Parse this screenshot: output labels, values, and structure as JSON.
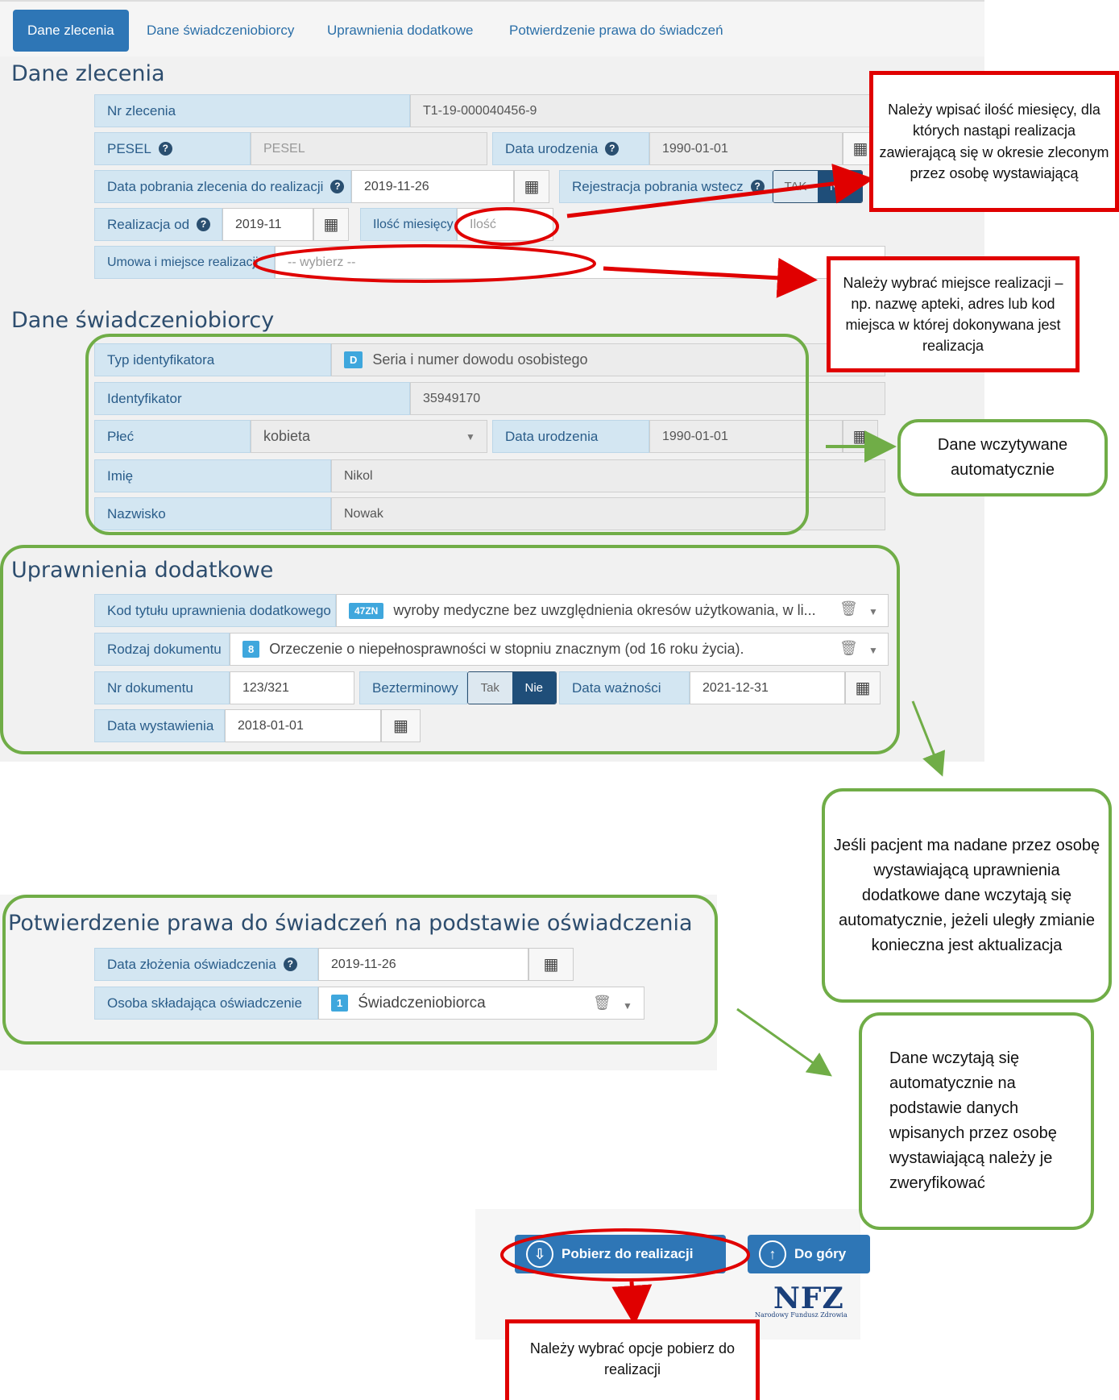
{
  "tabs": [
    "Dane zlecenia",
    "Dane świadczeniobiorcy",
    "Uprawnienia dodatkowe",
    "Potwierdzenie prawa do świadczeń"
  ],
  "dane_zlecenia": {
    "title": "Dane zlecenia",
    "nr_zlecenia_label": "Nr zlecenia",
    "nr_zlecenia_value": "T1-19-000040456-9",
    "pesel_label": "PESEL",
    "pesel_placeholder": "PESEL",
    "data_urodzenia_label": "Data urodzenia",
    "data_urodzenia_value": "1990-01-01",
    "data_pobrania_label": "Data pobrania zlecenia do realizacji",
    "data_pobrania_value": "2019-11-26",
    "rejestracja_label": "Rejestracja pobrania wstecz",
    "tak": "TAK",
    "nie": "NIE",
    "realizacja_od_label": "Realizacja od",
    "realizacja_od_value": "2019-11",
    "ilosc_label": "Ilość miesięcy",
    "ilosc_placeholder": "Ilość",
    "umowa_label": "Umowa i miejsce realizacji",
    "umowa_placeholder": "-- wybierz --"
  },
  "swiadczeniobiorca": {
    "title": "Dane świadczeniobiorcy",
    "typ_label": "Typ identyfikatora",
    "typ_badge": "D",
    "typ_value": "Seria i numer dowodu osobistego",
    "identyfikator_label": "Identyfikator",
    "identyfikator_value": "35949170",
    "plec_label": "Płeć",
    "plec_value": "kobieta",
    "data_urodzenia_label": "Data urodzenia",
    "data_urodzenia_value": "1990-01-01",
    "imie_label": "Imię",
    "imie_value": "Nikol",
    "nazwisko_label": "Nazwisko",
    "nazwisko_value": "Nowak"
  },
  "uprawnienia": {
    "title": "Uprawnienia dodatkowe",
    "kod_label": "Kod tytułu uprawnienia dodatkowego",
    "kod_badge": "47ZN",
    "kod_value": "wyroby medyczne bez uwzględnienia okresów użytkowania, w li...",
    "rodzaj_label": "Rodzaj dokumentu",
    "rodzaj_badge": "8",
    "rodzaj_value": "Orzeczenie o niepełnosprawności w stopniu znacznym (od 16 roku życia).",
    "nr_dok_label": "Nr dokumentu",
    "nr_dok_value": "123/321",
    "bezterminowy_label": "Bezterminowy",
    "tak": "Tak",
    "nie": "Nie",
    "data_waznosci_label": "Data ważności",
    "data_waznosci_value": "2021-12-31",
    "data_wystawienia_label": "Data wystawienia",
    "data_wystawienia_value": "2018-01-01"
  },
  "potwierdzenie": {
    "title": "Potwierdzenie prawa do świadczeń na podstawie oświadczenia",
    "data_zlozenia_label": "Data złożenia oświadczenia",
    "data_zlozenia_value": "2019-11-26",
    "osoba_label": "Osoba składająca oświadczenie",
    "osoba_badge": "1",
    "osoba_value": "Świadczeniobiorca"
  },
  "buttons": {
    "pobierz": "Pobierz do realizacji",
    "do_gory": "Do góry"
  },
  "logo": {
    "text": "NFZ",
    "subtitle": "Narodowy Fundusz Zdrowia"
  },
  "notes": {
    "ilosc": "Należy wpisać ilość miesięcy, dla których nastąpi realizacja zawierającą się w okresie zleconym przez osobę wystawiającą",
    "miejsce": "Należy wybrać miejsce realizacji – np. nazwę apteki, adres lub kod miejsca w której dokonywana jest realizacja",
    "auto": "Dane wczytywane automatycznie",
    "uprawnienia": "Jeśli pacjent ma nadane przez osobę wystawiającą uprawnienia dodatkowe dane wczytają się automatycznie, jeżeli uległy zmianie konieczna jest aktualizacja",
    "weryfikacja": "Dane wczytają się automatycznie na podstawie danych wpisanych przez osobę wystawiającą należy je zweryfikować",
    "pobierz": "Należy wybrać opcje pobierz do realizacji"
  },
  "colors": {
    "primary": "#2e76b6",
    "label_bg": "#d3e6f2",
    "red": "#e00000",
    "green": "#70ad47"
  }
}
